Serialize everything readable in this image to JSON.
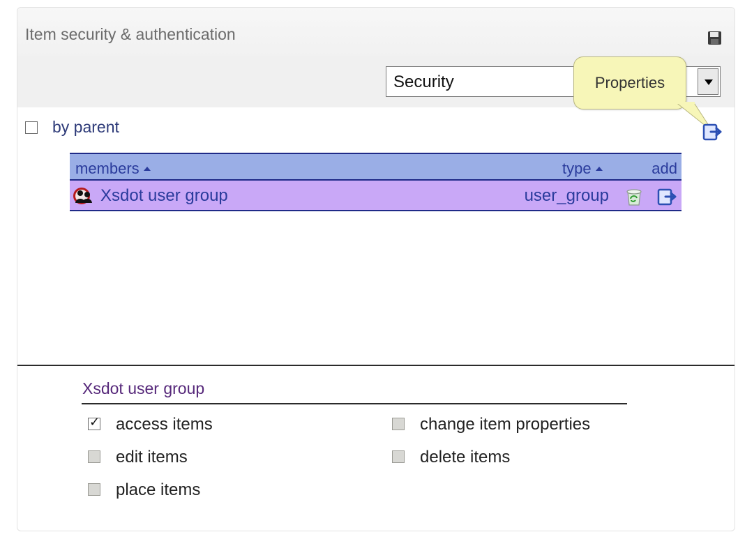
{
  "panel": {
    "title": "Item security & authentication",
    "save_icon": "floppy-disk-icon"
  },
  "toolbar": {
    "view_select": {
      "selected": "Security"
    },
    "tooltip": "Properties"
  },
  "by_parent": {
    "label": "by parent",
    "checked": false
  },
  "members_table": {
    "headers": {
      "members": "members",
      "type": "type",
      "add": "add"
    },
    "rows": [
      {
        "name": "Xsdot user group",
        "type": "user_group",
        "selected": true
      }
    ]
  },
  "permissions": {
    "group_name": "Xsdot user group",
    "items": [
      {
        "label": "access items",
        "checked": true,
        "enabled": true
      },
      {
        "label": "change item properties",
        "checked": false,
        "enabled": false
      },
      {
        "label": "edit items",
        "checked": false,
        "enabled": false
      },
      {
        "label": "delete items",
        "checked": false,
        "enabled": false
      },
      {
        "label": "place items",
        "checked": false,
        "enabled": false
      }
    ]
  },
  "colors": {
    "header_bg": "#9aaee6",
    "row_selected_bg": "#c9a8f7",
    "link_blue": "#2a3b9c",
    "tooltip_bg": "#f7f6b8"
  }
}
